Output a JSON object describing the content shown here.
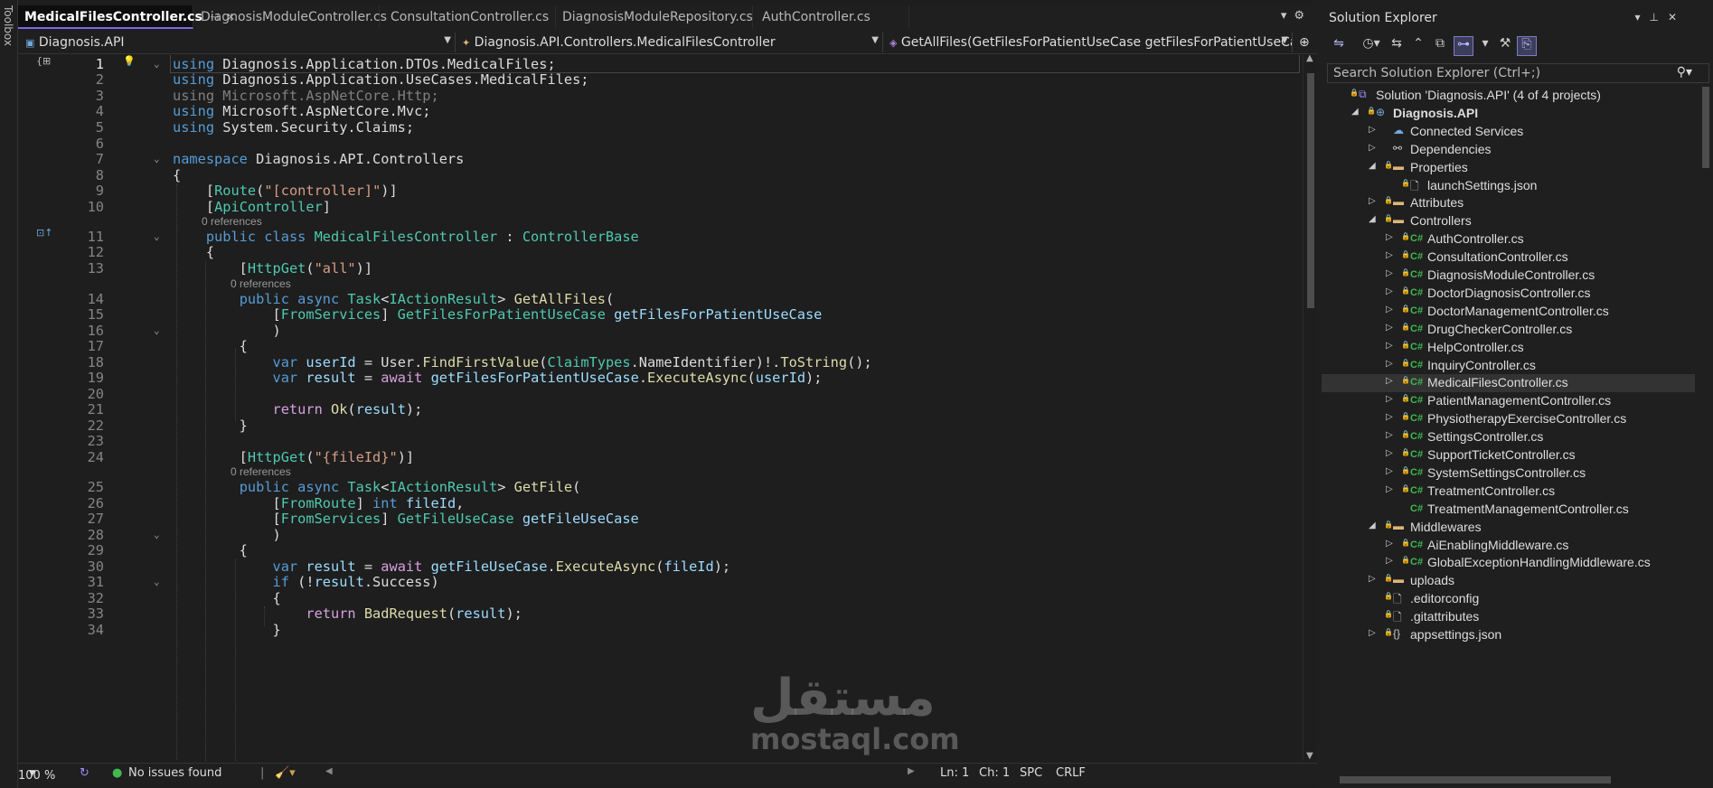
{
  "toolbox": {
    "label": "Toolbox"
  },
  "tabs": [
    {
      "label": "MedicalFilesController.cs",
      "active": true
    },
    {
      "label": "DiagnosisModuleController.cs",
      "active": false
    },
    {
      "label": "ConsultationController.cs",
      "active": false
    },
    {
      "label": "DiagnosisModuleRepository.cs",
      "active": false
    },
    {
      "label": "AuthController.cs",
      "active": false
    }
  ],
  "tab_icons": {
    "pin": "pin-icon",
    "close": "close-icon"
  },
  "nav": {
    "project": "Diagnosis.API",
    "class": "Diagnosis.API.Controllers.MedicalFilesController",
    "member": "GetAllFiles(GetFilesForPatientUseCase getFilesForPatientUseCase"
  },
  "code": {
    "line_numbers": [
      "1",
      "2",
      "3",
      "4",
      "5",
      "6",
      "7",
      "8",
      "9",
      "10",
      "11",
      "12",
      "13",
      "14",
      "15",
      "16",
      "17",
      "18",
      "19",
      "20",
      "21",
      "22",
      "23",
      "24",
      "25",
      "26",
      "27",
      "28",
      "29",
      "30",
      "31",
      "32",
      "33",
      "34"
    ],
    "references_label": "0 references"
  },
  "status": {
    "zoom": "100 %",
    "issues": "No issues found",
    "line": "Ln: 1",
    "char": "Ch: 1",
    "spc": "SPC",
    "eol": "CRLF"
  },
  "solution_explorer": {
    "title": "Solution Explorer",
    "search_placeholder": "Search Solution Explorer (Ctrl+;)",
    "items": [
      {
        "label": "Solution 'Diagnosis.API' (4 of 4 projects)",
        "kind": "solution"
      },
      {
        "label": "Diagnosis.API",
        "kind": "project"
      },
      {
        "label": "Connected Services",
        "kind": "service"
      },
      {
        "label": "Dependencies",
        "kind": "deps"
      },
      {
        "label": "Properties",
        "kind": "folder"
      },
      {
        "label": "launchSettings.json",
        "kind": "file"
      },
      {
        "label": "Attributes",
        "kind": "folder"
      },
      {
        "label": "Controllers",
        "kind": "folder"
      },
      {
        "label": "AuthController.cs",
        "kind": "cs"
      },
      {
        "label": "ConsultationController.cs",
        "kind": "cs"
      },
      {
        "label": "DiagnosisModuleController.cs",
        "kind": "cs"
      },
      {
        "label": "DoctorDiagnosisController.cs",
        "kind": "cs"
      },
      {
        "label": "DoctorManagementController.cs",
        "kind": "cs"
      },
      {
        "label": "DrugCheckerController.cs",
        "kind": "cs"
      },
      {
        "label": "HelpController.cs",
        "kind": "cs"
      },
      {
        "label": "InquiryController.cs",
        "kind": "cs"
      },
      {
        "label": "MedicalFilesController.cs",
        "kind": "cs",
        "selected": true
      },
      {
        "label": "PatientManagementController.cs",
        "kind": "cs"
      },
      {
        "label": "PhysiotherapyExerciseController.cs",
        "kind": "cs"
      },
      {
        "label": "SettingsController.cs",
        "kind": "cs"
      },
      {
        "label": "SupportTicketController.cs",
        "kind": "cs"
      },
      {
        "label": "SystemSettingsController.cs",
        "kind": "cs"
      },
      {
        "label": "TreatmentController.cs",
        "kind": "cs"
      },
      {
        "label": "TreatmentManagementController.cs",
        "kind": "cs"
      },
      {
        "label": "Middlewares",
        "kind": "folder"
      },
      {
        "label": "AiEnablingMiddleware.cs",
        "kind": "cs"
      },
      {
        "label": "GlobalExceptionHandlingMiddleware.cs",
        "kind": "cs"
      },
      {
        "label": "uploads",
        "kind": "folder"
      },
      {
        "label": ".editorconfig",
        "kind": "file"
      },
      {
        "label": ".gitattributes",
        "kind": "file"
      },
      {
        "label": "appsettings.json",
        "kind": "json"
      }
    ]
  },
  "watermark": {
    "arabic": "مستقل",
    "latin": "mostaql.com"
  },
  "colors": {
    "accent": "#7b68ee",
    "keyword": "#569cd6",
    "type": "#4ec9b0",
    "method": "#dcdcaa",
    "string": "#d69d85",
    "background": "#1e1e1e"
  }
}
